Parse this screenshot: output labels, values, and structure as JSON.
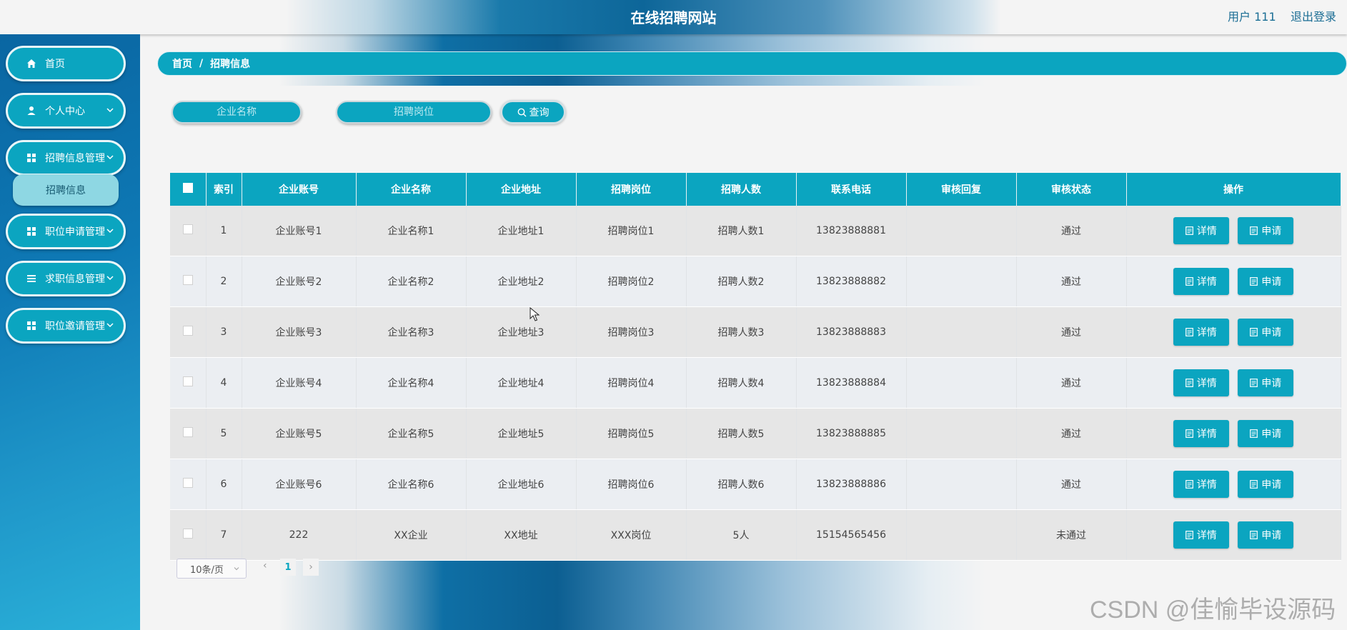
{
  "header": {
    "title": "在线招聘网站",
    "user": "用户 111",
    "logout": "退出登录"
  },
  "sidebar": {
    "items": [
      {
        "label": "首页",
        "icon": "home-icon"
      },
      {
        "label": "个人中心",
        "icon": "user-icon"
      },
      {
        "label": "招聘信息管理",
        "icon": "grid-icon"
      },
      {
        "label": "职位申请管理",
        "icon": "grid-icon"
      },
      {
        "label": "求职信息管理",
        "icon": "list-icon"
      },
      {
        "label": "职位邀请管理",
        "icon": "grid-icon"
      }
    ],
    "submenu": {
      "label": "招聘信息"
    }
  },
  "breadcrumb": {
    "home": "首页",
    "separator": "/",
    "current": "招聘信息"
  },
  "search": {
    "company_placeholder": "企业名称",
    "position_placeholder": "招聘岗位",
    "query_label": "查询"
  },
  "table": {
    "headers": [
      "索引",
      "企业账号",
      "企业名称",
      "企业地址",
      "招聘岗位",
      "招聘人数",
      "联系电话",
      "审核回复",
      "审核状态",
      "操作"
    ],
    "rows": [
      {
        "index": "1",
        "account": "企业账号1",
        "name": "企业名称1",
        "address": "企业地址1",
        "position": "招聘岗位1",
        "count": "招聘人数1",
        "phone": "13823888881",
        "reply": "",
        "status": "通过"
      },
      {
        "index": "2",
        "account": "企业账号2",
        "name": "企业名称2",
        "address": "企业地址2",
        "position": "招聘岗位2",
        "count": "招聘人数2",
        "phone": "13823888882",
        "reply": "",
        "status": "通过"
      },
      {
        "index": "3",
        "account": "企业账号3",
        "name": "企业名称3",
        "address": "企业地址3",
        "position": "招聘岗位3",
        "count": "招聘人数3",
        "phone": "13823888883",
        "reply": "",
        "status": "通过"
      },
      {
        "index": "4",
        "account": "企业账号4",
        "name": "企业名称4",
        "address": "企业地址4",
        "position": "招聘岗位4",
        "count": "招聘人数4",
        "phone": "13823888884",
        "reply": "",
        "status": "通过"
      },
      {
        "index": "5",
        "account": "企业账号5",
        "name": "企业名称5",
        "address": "企业地址5",
        "position": "招聘岗位5",
        "count": "招聘人数5",
        "phone": "13823888885",
        "reply": "",
        "status": "通过"
      },
      {
        "index": "6",
        "account": "企业账号6",
        "name": "企业名称6",
        "address": "企业地址6",
        "position": "招聘岗位6",
        "count": "招聘人数6",
        "phone": "13823888886",
        "reply": "",
        "status": "通过"
      },
      {
        "index": "7",
        "account": "222",
        "name": "XX企业",
        "address": "XX地址",
        "position": "XXX岗位",
        "count": "5人",
        "phone": "15154565456",
        "reply": "",
        "status": "未通过"
      }
    ],
    "actions": {
      "detail": "详情",
      "apply": "申请"
    }
  },
  "pagination": {
    "page_size": "10条/页",
    "current_page": "1",
    "prev": "‹",
    "next": "›"
  },
  "watermark": "CSDN @佳愉毕设源码",
  "colors": {
    "accent": "#0ba5c0",
    "sidebar": "#0e79b5",
    "title": "#ffffff"
  }
}
